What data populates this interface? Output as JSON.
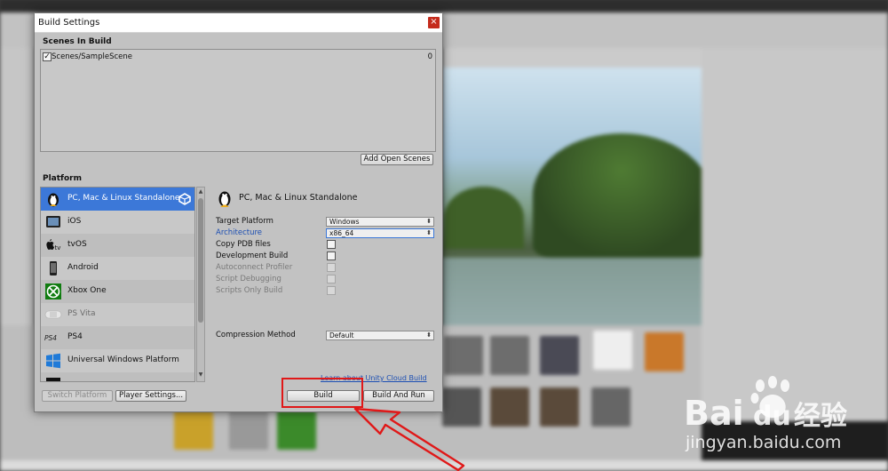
{
  "dialog": {
    "title": "Build Settings",
    "close_glyph": "×",
    "scenes_header": "Scenes In Build",
    "scenes": [
      {
        "name": "Scenes/SampleScene",
        "index": "0",
        "checked": true
      }
    ],
    "add_open_scenes": "Add Open Scenes",
    "platform_header": "Platform",
    "platforms": [
      {
        "label": "PC, Mac & Linux Standalone",
        "icon": "pc-mac-linux-icon",
        "selected": true
      },
      {
        "label": "iOS",
        "icon": "ios-device-icon"
      },
      {
        "label": "tvOS",
        "icon": "apple-tv-icon"
      },
      {
        "label": "Android",
        "icon": "android-device-icon"
      },
      {
        "label": "Xbox One",
        "icon": "xbox-icon"
      },
      {
        "label": "PS Vita",
        "icon": "ps-vita-icon",
        "dim": true
      },
      {
        "label": "PS4",
        "icon": "ps4-icon"
      },
      {
        "label": "Universal Windows Platform",
        "icon": "windows-icon"
      }
    ],
    "selected_platform_title": "PC, Mac & Linux Standalone",
    "settings": {
      "target_platform": {
        "label": "Target Platform",
        "value": "Windows"
      },
      "architecture": {
        "label": "Architecture",
        "value": "x86_64"
      },
      "copy_pdb": {
        "label": "Copy PDB files"
      },
      "development_build": {
        "label": "Development Build"
      },
      "autoconnect_profiler": {
        "label": "Autoconnect Profiler"
      },
      "script_debugging": {
        "label": "Script Debugging"
      },
      "scripts_only_build": {
        "label": "Scripts Only Build"
      },
      "compression_method": {
        "label": "Compression Method",
        "value": "Default"
      }
    },
    "cloud_link": "Learn about Unity Cloud Build",
    "buttons": {
      "switch_platform": "Switch Platform",
      "player_settings": "Player Settings...",
      "build": "Build",
      "build_and_run": "Build And Run"
    }
  },
  "colors": {
    "selection": "#3c78d8",
    "highlight_box": "#e01818",
    "close_button": "#c42b1c",
    "link": "#1d4fb3"
  }
}
